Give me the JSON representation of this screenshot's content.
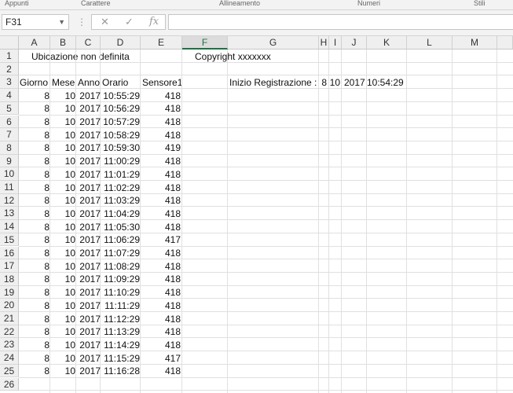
{
  "ribbon": [
    "Appunti",
    "Carattere",
    "Allineamento",
    "Numeri",
    "Stili"
  ],
  "name_box": "F31",
  "formula_icons": {
    "cancel": "✕",
    "enter": "✓",
    "function": "fx"
  },
  "columns": [
    "A",
    "B",
    "C",
    "D",
    "E",
    "F",
    "G",
    "H",
    "I",
    "J",
    "K",
    "L",
    "M"
  ],
  "selected_column": "F",
  "row_numbers": [
    "1",
    "2",
    "3",
    "4",
    "5",
    "6",
    "7",
    "8",
    "9",
    "10",
    "11",
    "12",
    "13",
    "14",
    "15",
    "16",
    "17",
    "18",
    "19",
    "20",
    "21",
    "22",
    "23",
    "24",
    "25",
    "26"
  ],
  "sheet": {
    "location_label": "Ubicazione non definita",
    "copyright": "Copyright xxxxxxx",
    "headers": [
      "Giorno",
      "Mese",
      "Anno",
      "Orario",
      "Sensore1"
    ],
    "start_label": "Inizio Registrazione :",
    "start_day": "8",
    "start_month": "10",
    "start_year": "2017",
    "start_time": "10:54:29",
    "rows": [
      [
        "8",
        "10",
        "2017",
        "10:55:29",
        "418"
      ],
      [
        "8",
        "10",
        "2017",
        "10:56:29",
        "418"
      ],
      [
        "8",
        "10",
        "2017",
        "10:57:29",
        "418"
      ],
      [
        "8",
        "10",
        "2017",
        "10:58:29",
        "418"
      ],
      [
        "8",
        "10",
        "2017",
        "10:59:30",
        "419"
      ],
      [
        "8",
        "10",
        "2017",
        "11:00:29",
        "418"
      ],
      [
        "8",
        "10",
        "2017",
        "11:01:29",
        "418"
      ],
      [
        "8",
        "10",
        "2017",
        "11:02:29",
        "418"
      ],
      [
        "8",
        "10",
        "2017",
        "11:03:29",
        "418"
      ],
      [
        "8",
        "10",
        "2017",
        "11:04:29",
        "418"
      ],
      [
        "8",
        "10",
        "2017",
        "11:05:30",
        "418"
      ],
      [
        "8",
        "10",
        "2017",
        "11:06:29",
        "417"
      ],
      [
        "8",
        "10",
        "2017",
        "11:07:29",
        "418"
      ],
      [
        "8",
        "10",
        "2017",
        "11:08:29",
        "418"
      ],
      [
        "8",
        "10",
        "2017",
        "11:09:29",
        "418"
      ],
      [
        "8",
        "10",
        "2017",
        "11:10:29",
        "418"
      ],
      [
        "8",
        "10",
        "2017",
        "11:11:29",
        "418"
      ],
      [
        "8",
        "10",
        "2017",
        "11:12:29",
        "418"
      ],
      [
        "8",
        "10",
        "2017",
        "11:13:29",
        "418"
      ],
      [
        "8",
        "10",
        "2017",
        "11:14:29",
        "418"
      ],
      [
        "8",
        "10",
        "2017",
        "11:15:29",
        "417"
      ],
      [
        "8",
        "10",
        "2017",
        "11:16:28",
        "418"
      ]
    ]
  }
}
